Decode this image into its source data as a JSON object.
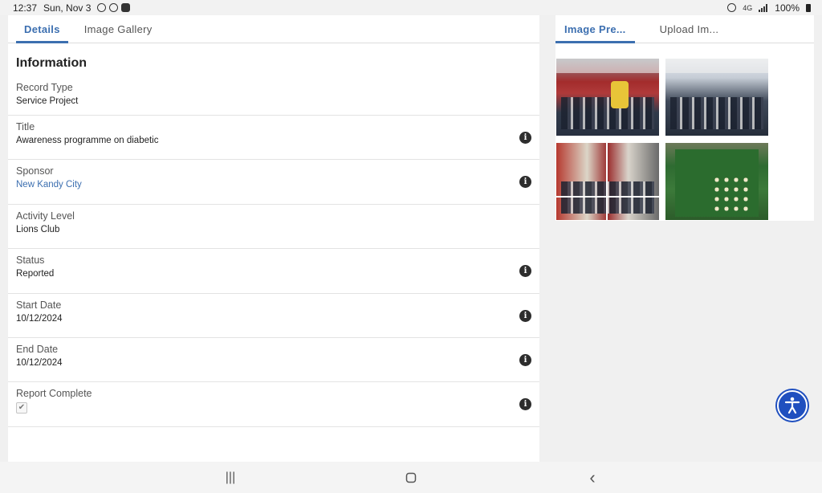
{
  "status_bar": {
    "time": "12:37",
    "date": "Sun, Nov 3",
    "signal": "4G",
    "battery": "100%"
  },
  "details": {
    "tabs": [
      {
        "label": "Details",
        "active": true
      },
      {
        "label": "Image Gallery",
        "active": false
      }
    ],
    "section_title": "Information",
    "fields": [
      {
        "label": "Record Type",
        "value": "Service Project"
      },
      {
        "label": "Title",
        "value": "Awareness programme on diabetic"
      },
      {
        "label": "Sponsor",
        "value": "New Kandy City"
      },
      {
        "label": "Activity Level",
        "value": "Lions Club"
      },
      {
        "label": "Status",
        "value": "Reported"
      },
      {
        "label": "Start Date",
        "value": "10/12/2024"
      },
      {
        "label": "End Date",
        "value": "10/12/2024"
      },
      {
        "label": "Report Complete",
        "checked": true
      }
    ],
    "info_glyph": "i"
  },
  "gallery": {
    "tabs": [
      {
        "label": "Image Pre...",
        "active": true
      },
      {
        "label": "Upload Im...",
        "active": false
      }
    ]
  },
  "colors": {
    "accent": "#3c6fb0",
    "a11y": "#1f4fbf"
  },
  "nav": {
    "recents_glyph": "|||",
    "back_glyph": "‹"
  }
}
